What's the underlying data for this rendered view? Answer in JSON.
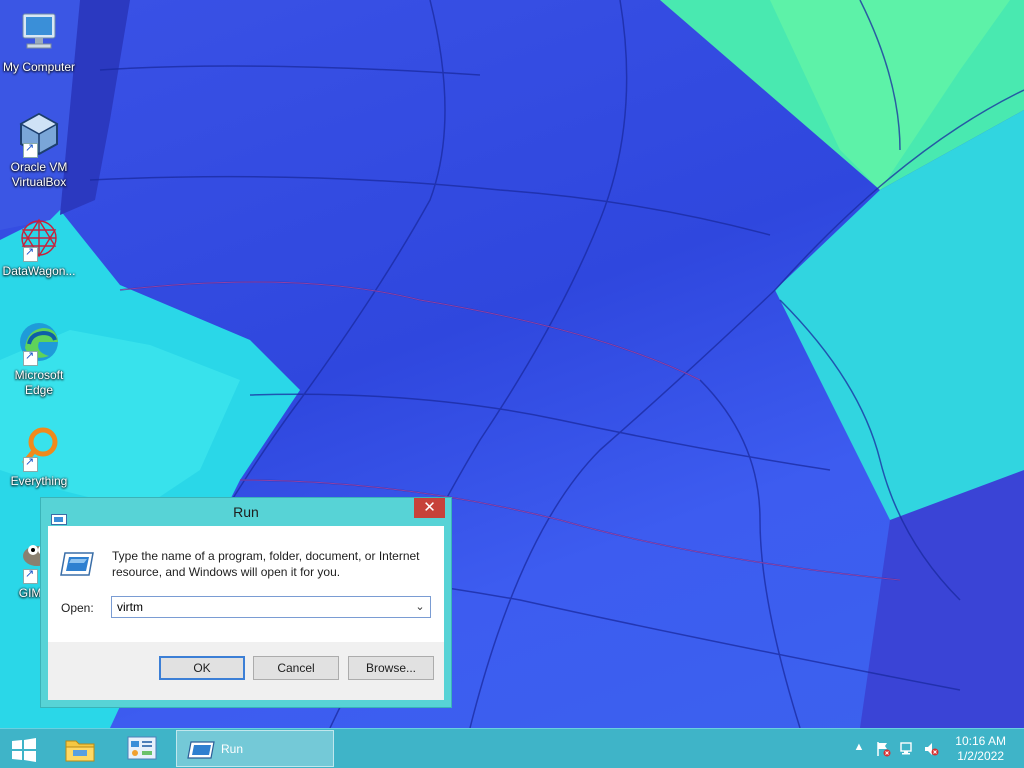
{
  "desktop": {
    "icons": [
      {
        "label": "My Computer",
        "icon": "computer-icon"
      },
      {
        "label": "Oracle VM VirtualBox",
        "icon": "virtualbox-icon"
      },
      {
        "label": "DataWagon...",
        "icon": "datawagon-icon"
      },
      {
        "label": "Microsoft Edge",
        "icon": "edge-icon"
      },
      {
        "label": "Everything",
        "icon": "everything-search-icon"
      },
      {
        "label": "GIMP 2",
        "icon": "gimp-icon"
      }
    ]
  },
  "run_dialog": {
    "title": "Run",
    "close_glyph": "✕",
    "description": "Type the name of a program, folder, document, or Internet resource, and Windows will open it for you.",
    "open_label": "Open:",
    "open_value": "virtm",
    "ok_label": "OK",
    "cancel_label": "Cancel",
    "browse_label": "Browse..."
  },
  "taskbar": {
    "running_app_label": "Run",
    "clock_time": "10:16 AM",
    "clock_date": "1/2/2022",
    "tray_icons": [
      "show-hidden-icons-arrow",
      "action-center-flag-icon",
      "network-icon",
      "volume-muted-icon"
    ]
  },
  "colors": {
    "taskbar": "#3fb4c8",
    "dialog_frame": "#57d3d6",
    "close_button": "#c7423a"
  }
}
